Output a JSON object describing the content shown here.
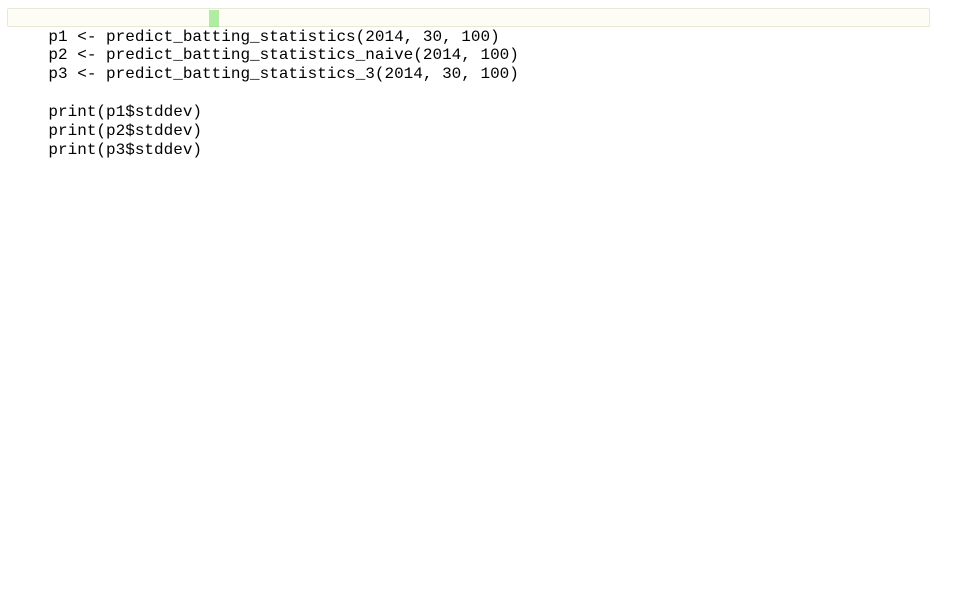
{
  "editor": {
    "lines": [
      "p1 <- predict_batting_statistics(2014, 30, 100)",
      "p2 <- predict_batting_statistics_naive(2014, 100)",
      "p3 <- predict_batting_statistics_3(2014, 30, 100)",
      "",
      "print(p1$stddev)",
      "print(p2$stddev)",
      "print(p3$stddev)"
    ],
    "currentLine": 0,
    "cursorColumn": 25
  }
}
